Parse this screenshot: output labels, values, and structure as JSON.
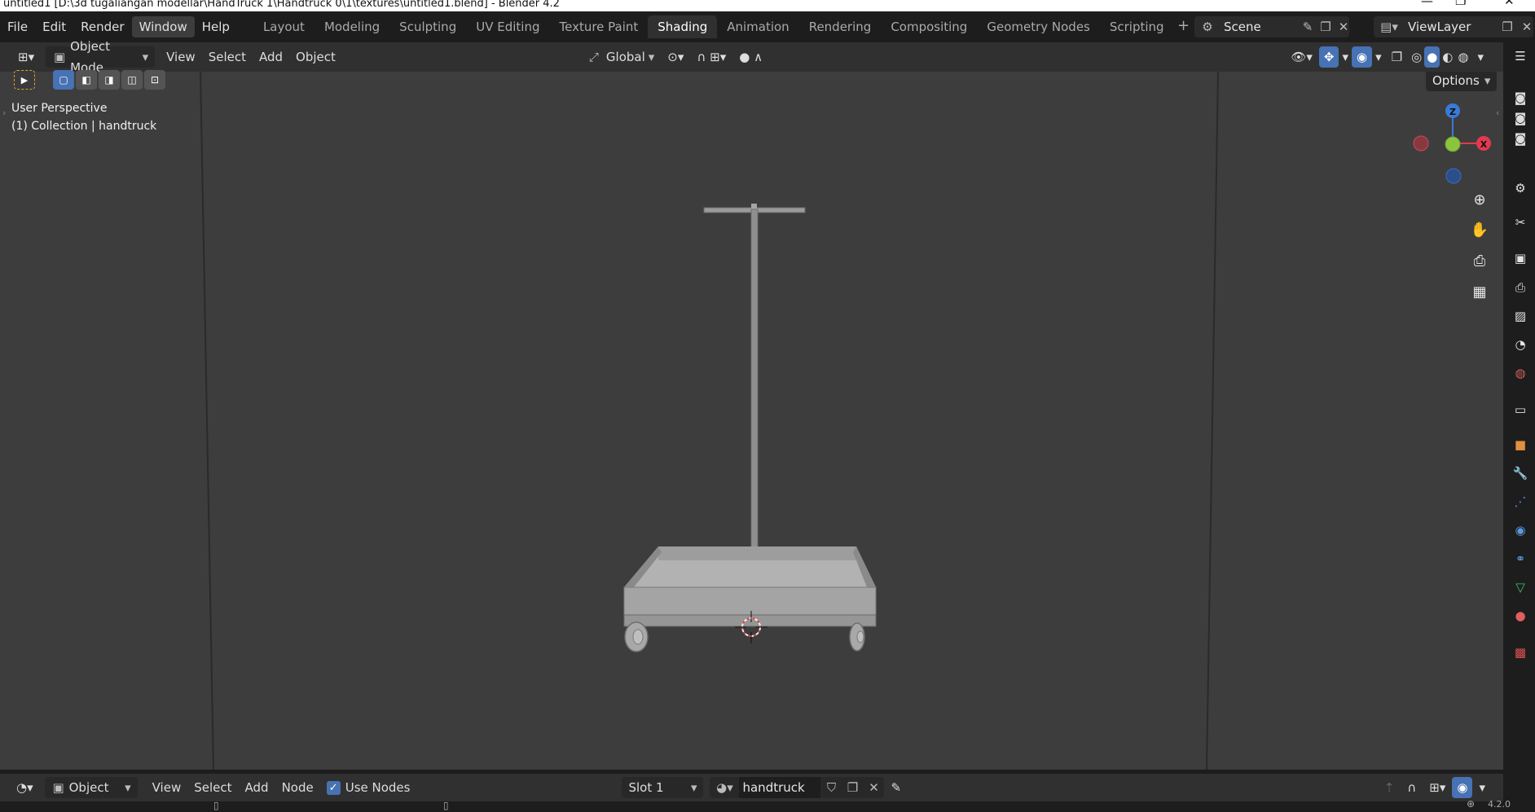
{
  "window": {
    "title": "untitled1 [D:\\3d tugaliangan modellar\\HandTruck 1\\Handtruck 0\\1\\textures\\untitled1.blend] - Blender 4.2"
  },
  "menu": {
    "file": "File",
    "edit": "Edit",
    "render": "Render",
    "window": "Window",
    "help": "Help"
  },
  "workspaces": [
    {
      "label": "Layout",
      "active": false
    },
    {
      "label": "Modeling",
      "active": false
    },
    {
      "label": "Sculpting",
      "active": false
    },
    {
      "label": "UV Editing",
      "active": false
    },
    {
      "label": "Texture Paint",
      "active": false
    },
    {
      "label": "Shading",
      "active": true
    },
    {
      "label": "Animation",
      "active": false
    },
    {
      "label": "Rendering",
      "active": false
    },
    {
      "label": "Compositing",
      "active": false
    },
    {
      "label": "Geometry Nodes",
      "active": false
    },
    {
      "label": "Scripting",
      "active": false
    }
  ],
  "scene": {
    "name": "Scene"
  },
  "view_layer": {
    "name": "ViewLayer"
  },
  "viewport_header": {
    "mode": "Object Mode",
    "view": "View",
    "select": "Select",
    "add": "Add",
    "object": "Object",
    "transform_orientation": "Global",
    "options": "Options"
  },
  "viewport": {
    "perspective": "User Perspective",
    "collection": "(1) Collection | handtruck",
    "gizmo": {
      "z": "Z",
      "x": "X"
    }
  },
  "shader_header": {
    "editor_type": "Object",
    "view": "View",
    "select": "Select",
    "add": "Add",
    "node": "Node",
    "use_nodes": "Use Nodes",
    "use_nodes_checked": true,
    "slot": "Slot 1",
    "material": "handtruck"
  },
  "status_bar": {
    "version": "4.2.0"
  },
  "colors": {
    "accent_blue": "#4772b3",
    "axis_x": "#e2394f",
    "axis_y": "#8bc53f",
    "axis_z": "#3a7ad6",
    "viewport_bg": "#3d3d3d"
  }
}
